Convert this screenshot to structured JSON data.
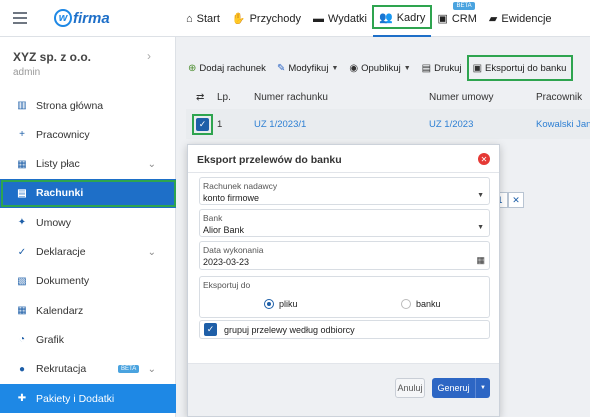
{
  "brand": {
    "logo_letter": "w",
    "logo_text": "firma"
  },
  "nav": [
    {
      "label": "Start",
      "icon": "home-icon",
      "glyph": "⌂"
    },
    {
      "label": "Przychody",
      "icon": "hand-coins-icon",
      "glyph": "✋"
    },
    {
      "label": "Wydatki",
      "icon": "wallet-icon",
      "glyph": "▬"
    },
    {
      "label": "Kadry",
      "icon": "users-icon",
      "glyph": "👥"
    },
    {
      "label": "CRM",
      "icon": "id-card-icon",
      "glyph": "▣",
      "badge": "BETA"
    },
    {
      "label": "Ewidencje",
      "icon": "folder-icon",
      "glyph": "▰"
    }
  ],
  "nav_active": "Kadry",
  "sidebar": {
    "company": "XYZ sp. z o.o.",
    "user": "admin",
    "items": [
      {
        "label": "Strona główna",
        "icon": "chart-icon",
        "glyph": "▥"
      },
      {
        "label": "Pracownicy",
        "icon": "user-plus-icon",
        "glyph": "+"
      },
      {
        "label": "Listy płac",
        "icon": "calculator-icon",
        "glyph": "▦",
        "chevron": true
      },
      {
        "label": "Rachunki",
        "icon": "receipt-icon",
        "glyph": "▤",
        "active": true
      },
      {
        "label": "Umowy",
        "icon": "handshake-icon",
        "glyph": "✦"
      },
      {
        "label": "Deklaracje",
        "icon": "clipboard-check-icon",
        "glyph": "✓",
        "chevron": true
      },
      {
        "label": "Dokumenty",
        "icon": "documents-icon",
        "glyph": "▧"
      },
      {
        "label": "Kalendarz",
        "icon": "calendar-icon",
        "glyph": "▦"
      },
      {
        "label": "Grafik",
        "icon": "clock-icon",
        "glyph": "◔"
      },
      {
        "label": "Rekrutacja",
        "icon": "users-icon",
        "glyph": "●",
        "chevron": true,
        "badge": "BETA"
      },
      {
        "label": "Pakiety i Dodatki",
        "icon": "puzzle-icon",
        "glyph": "✚",
        "last": true
      }
    ]
  },
  "toolbar": {
    "add": "Dodaj rachunek",
    "modify": "Modyfikuj",
    "publish": "Opublikuj",
    "print": "Drukuj",
    "export": "Eksportuj do banku"
  },
  "table": {
    "headers": {
      "lp": "Lp.",
      "number": "Numer rachunku",
      "contract": "Numer umowy",
      "employee": "Pracownik"
    },
    "rows": [
      {
        "lp": "1",
        "number": "UZ 1/2023/1",
        "contract": "UZ 1/2023",
        "employee": "Kowalski Jan"
      }
    ]
  },
  "modal": {
    "title": "Eksport przelewów do banku",
    "sender_label": "Rachunek nadawcy",
    "sender_value": "konto firmowe",
    "bank_label": "Bank",
    "bank_value": "Alior Bank",
    "date_label": "Data wykonania",
    "date_value": "2023-03-23",
    "export_label": "Eksportuj do",
    "option_file": "pliku",
    "option_bank": "banku",
    "selected_option": "pliku",
    "group_label": "grupuj przelewy według odbiorcy",
    "group_checked": true,
    "cancel": "Anuluj",
    "generate": "Generuj"
  },
  "colors": {
    "accent": "#1e6fc8",
    "highlight": "#2ea44f",
    "close": "#e53935"
  }
}
